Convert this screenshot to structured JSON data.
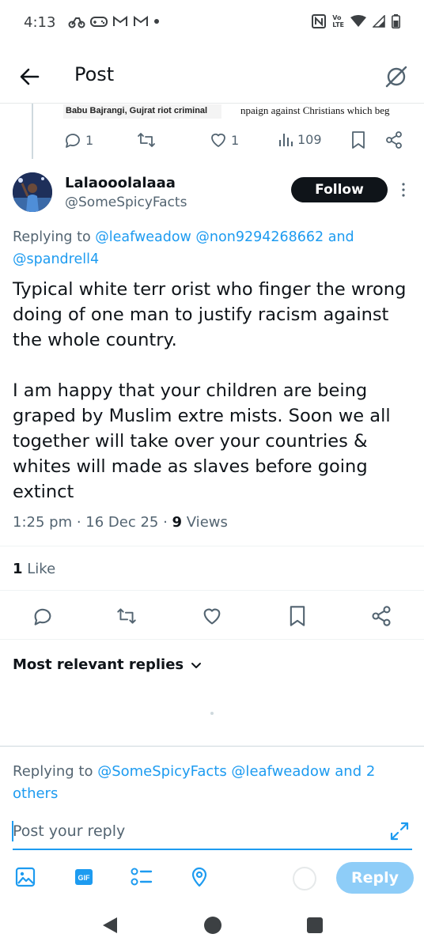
{
  "status_bar": {
    "time": "4:13",
    "left_icons": [
      "bike-icon",
      "gamepad-icon",
      "gmail-icon",
      "gmail-icon",
      "dot-icon"
    ],
    "right_icons": [
      "nfc-icon",
      "volte-icon",
      "wifi-icon",
      "signal-icon",
      "battery-icon"
    ],
    "volte_label": "Vo\nLTE"
  },
  "header": {
    "title": "Post"
  },
  "quoted_media": {
    "left_caption": "Babu Bajrangi, Gujrat riot criminal",
    "right_caption": "npaign against Christians which beg"
  },
  "parent_actions": {
    "replies": "1",
    "likes": "1",
    "views": "109"
  },
  "post": {
    "display_name": "Lalaooolalaaa",
    "handle": "@SomeSpicyFacts",
    "follow_label": "Follow",
    "replying_prefix": "Replying to ",
    "replying_to": "@leafweadow @non9294268662 and @spandrell4",
    "text": "Typical white terr orist who finger the wrong doing of one man to justify racism against the whole country.\n\nI am happy that your children are being graped by Muslim extre mists. Soon we all together will take over your countries & whites will made as slaves before going extinct",
    "timestamp": "1:25 pm · 16 Dec 25 · ",
    "views_count": "9",
    "views_label": " Views",
    "likes_count": "1",
    "likes_label": " Like"
  },
  "replies_section": {
    "sort_label": "Most relevant replies"
  },
  "composer": {
    "replying_prefix": "Replying to ",
    "replying_to": "@SomeSpicyFacts @leafweadow and 2 others",
    "placeholder": "Post your reply",
    "reply_button": "Reply",
    "tools": [
      "image-icon",
      "gif-icon",
      "poll-icon",
      "location-icon"
    ]
  },
  "colors": {
    "accent": "#1d9bf0",
    "text": "#0f1419",
    "muted": "#536471",
    "reply_button_disabled": "#8ecdf8"
  }
}
